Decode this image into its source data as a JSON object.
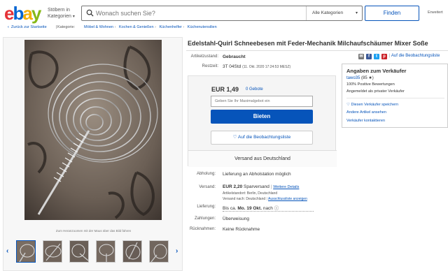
{
  "header": {
    "logo_letters": [
      "e",
      "b",
      "a",
      "y"
    ],
    "browse_line1": "Stöbern in",
    "browse_line2": "Kategorien",
    "search_placeholder": "Wonach suchen Sie?",
    "category_select": "Alle Kategorien",
    "find_button": "Finden",
    "advanced": "Erweitert"
  },
  "breadcrumb": {
    "back": "Zurück zur Startseite",
    "category_label": "Kategorie:",
    "items": [
      "Möbel & Wohnen",
      "Kochen & Genießen",
      "Küchenhelfer",
      "Küchenutensilien"
    ]
  },
  "gallery": {
    "zoom_hint": "Zum Heranzoomen mit der Maus über das Bild fahren",
    "thumb_count": 7
  },
  "listing": {
    "title": "Edelstahl-Quirl Schneebesen mit Feder-Mechanik Milchaufschäumer Mixer Soße",
    "condition_label": "Artikelzustand:",
    "condition": "Gebraucht",
    "time_label": "Restzeit:",
    "time_left": "3T 04Std",
    "time_end": "(11. Okt. 2020  17:24:53 MESZ)",
    "share_icons": [
      "email-icon",
      "facebook-icon",
      "twitter-icon",
      "pinterest-icon"
    ],
    "watch_link": "Auf die Beobachtungsliste"
  },
  "bidbox": {
    "price": "EUR 1,49",
    "bids": "0 Gebote",
    "maxbid_placeholder": "Geben Sie Ihr Maximalgebot ein",
    "bid_button": "Bieten",
    "watch_button": "Auf die Beobachtungsliste",
    "ship_from": "Versand aus Deutschland"
  },
  "seller": {
    "heading": "Angaben zum Verkäufer",
    "name": "tawo35",
    "feedback": "(85 ★)",
    "positive": "100% Positive Bewertungen",
    "private": "Angemeldet als privater Verkäufer",
    "save_seller": "Diesen Verkäufer speichern",
    "other_items": "Andere Artikel ansehen",
    "contact": "Verkäufer kontaktieren"
  },
  "details": {
    "pickup_label": "Abholung:",
    "pickup": "Lieferung an Abholstation möglich",
    "shipping_label": "Versand:",
    "shipping_price": "EUR 2,20",
    "shipping_type": "Sparversand",
    "shipping_more": "Weitere Details",
    "location": "Artikelstandort: Berlin, Deutschland",
    "ships_to": "Versand nach: Deutschland",
    "exclusions": "Ausschlussliste anzeigen",
    "delivery_label": "Lieferung:",
    "delivery_prefix": "Bis ca.",
    "delivery_date": "Mo. 19 Okt.",
    "delivery_suffix": "nach",
    "payment_label": "Zahlungen:",
    "payment": "Überweisung",
    "returns_label": "Rücknahmen:",
    "returns": "Keine Rücknahme"
  },
  "colors": {
    "link": "#0654ba",
    "primary_button": "#0654ba"
  }
}
